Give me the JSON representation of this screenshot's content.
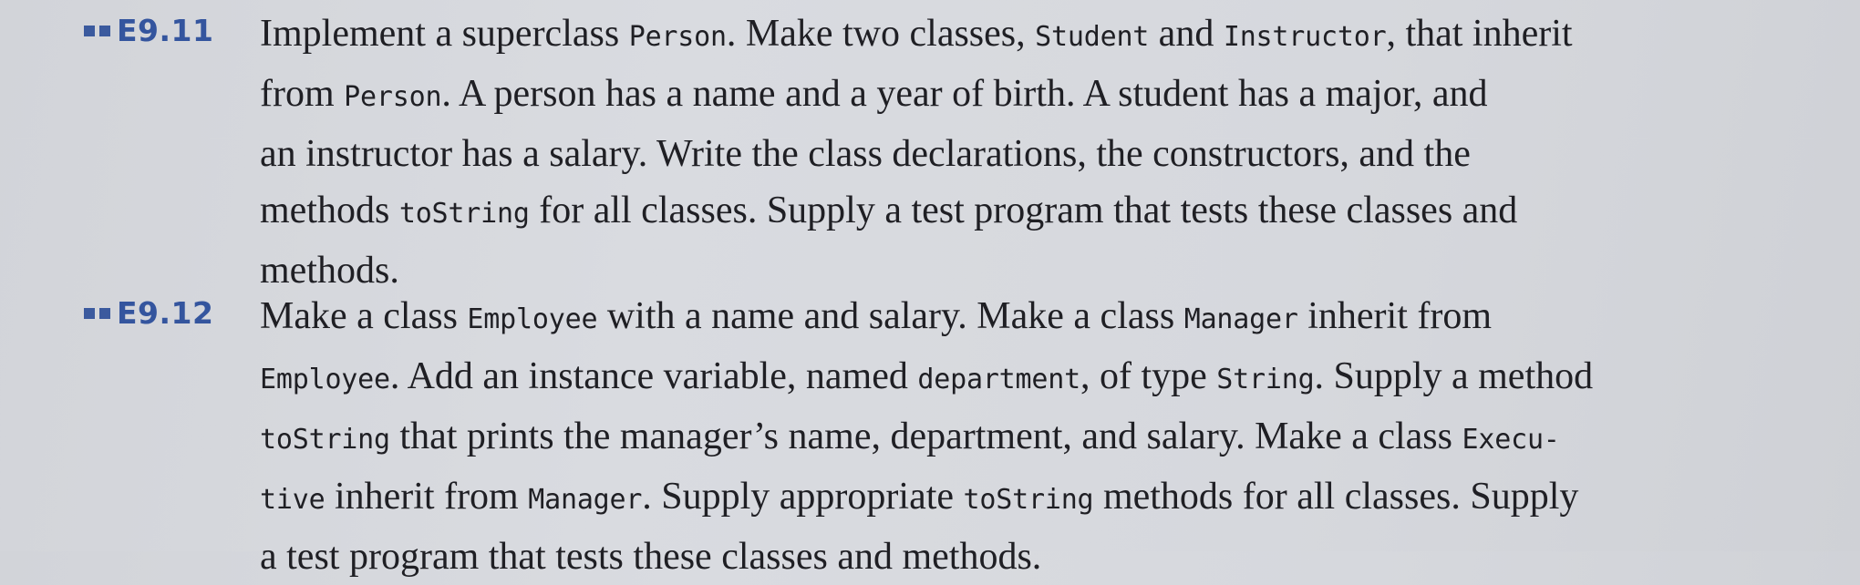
{
  "exercises": [
    {
      "number": "E9.11",
      "lines": [
        [
          {
            "t": "text",
            "v": "Implement a superclass "
          },
          {
            "t": "code",
            "v": "Person"
          },
          {
            "t": "text",
            "v": ". Make two classes, "
          },
          {
            "t": "code",
            "v": "Student"
          },
          {
            "t": "text",
            "v": " and "
          },
          {
            "t": "code",
            "v": "Instructor"
          },
          {
            "t": "text",
            "v": ", that inherit"
          }
        ],
        [
          {
            "t": "text",
            "v": "from "
          },
          {
            "t": "code",
            "v": "Person"
          },
          {
            "t": "text",
            "v": ". A person has a name and a year of birth. A student has a major, and"
          }
        ],
        [
          {
            "t": "text",
            "v": "an instructor has a salary. Write the class declarations, the constructors, and the"
          }
        ],
        [
          {
            "t": "text",
            "v": "methods "
          },
          {
            "t": "code",
            "v": "toString"
          },
          {
            "t": "text",
            "v": " for all classes. Supply a test program that tests these classes and"
          }
        ],
        [
          {
            "t": "text",
            "v": "methods."
          }
        ]
      ]
    },
    {
      "number": "E9.12",
      "lines": [
        [
          {
            "t": "text",
            "v": "Make a class "
          },
          {
            "t": "code",
            "v": "Employee"
          },
          {
            "t": "text",
            "v": " with a name and salary. Make a class "
          },
          {
            "t": "code",
            "v": "Manager"
          },
          {
            "t": "text",
            "v": " inherit from"
          }
        ],
        [
          {
            "t": "code",
            "v": "Employee"
          },
          {
            "t": "text",
            "v": ". Add an instance variable, named "
          },
          {
            "t": "code",
            "v": "department"
          },
          {
            "t": "text",
            "v": ", of type "
          },
          {
            "t": "code",
            "v": "String"
          },
          {
            "t": "text",
            "v": ". Supply a method"
          }
        ],
        [
          {
            "t": "code",
            "v": "toString"
          },
          {
            "t": "text",
            "v": " that prints the manager’s name, department, and salary. Make a class "
          },
          {
            "t": "code",
            "v": "Execu-"
          }
        ],
        [
          {
            "t": "code",
            "v": "tive"
          },
          {
            "t": "text",
            "v": " inherit from "
          },
          {
            "t": "code",
            "v": "Manager"
          },
          {
            "t": "text",
            "v": ". Supply appropriate "
          },
          {
            "t": "code",
            "v": "toString"
          },
          {
            "t": "text",
            "v": " methods for all classes. Supply"
          }
        ],
        [
          {
            "t": "text",
            "v": "a test program that tests these classes and methods."
          }
        ]
      ]
    }
  ]
}
